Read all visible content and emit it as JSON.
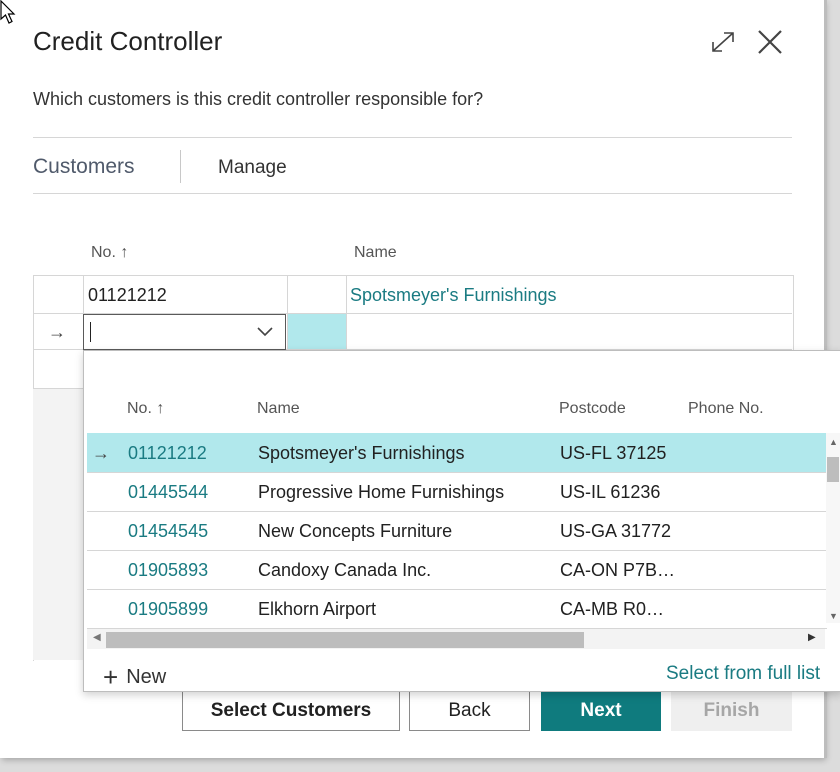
{
  "dialog": {
    "title": "Credit Controller",
    "question": "Which customers is this credit controller responsible for?"
  },
  "tabs": {
    "customers": "Customers",
    "manage": "Manage"
  },
  "grid": {
    "col_no": "No. ↑",
    "col_name": "Name",
    "rows": [
      {
        "no": "01121212",
        "name": "Spotsmeyer's Furnishings"
      }
    ],
    "row_arrow": "→"
  },
  "lookup": {
    "headers": {
      "no": "No. ↑",
      "name": "Name",
      "postcode": "Postcode",
      "phone": "Phone No."
    },
    "selected_arrow": "→",
    "rows": [
      {
        "no": "01121212",
        "name": "Spotsmeyer's Furnishings",
        "postcode": "US-FL 37125"
      },
      {
        "no": "01445544",
        "name": "Progressive Home Furnishings",
        "postcode": "US-IL 61236"
      },
      {
        "no": "01454545",
        "name": "New Concepts Furniture",
        "postcode": "US-GA 31772"
      },
      {
        "no": "01905893",
        "name": "Candoxy Canada Inc.",
        "postcode": "CA-ON P7B…"
      },
      {
        "no": "01905899",
        "name": "Elkhorn Airport",
        "postcode": "CA-MB R0…"
      }
    ],
    "new_label": "New",
    "full_list_label": "Select from full list"
  },
  "buttons": {
    "select_customers": "Select Customers",
    "back": "Back",
    "next": "Next",
    "finish": "Finish"
  },
  "colors": {
    "accent": "#0f7b7e",
    "link": "#1a7b82",
    "selected_row": "#b1e8ec"
  }
}
